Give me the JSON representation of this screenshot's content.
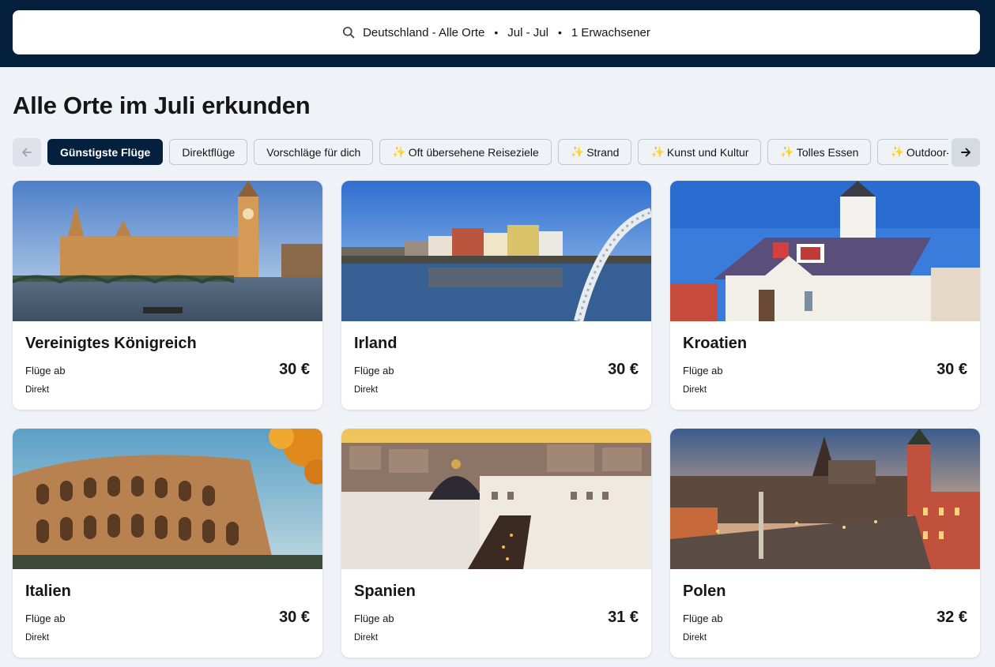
{
  "search": {
    "destination": "Deutschland - Alle Orte",
    "dates": "Jul - Jul",
    "travellers": "1 Erwachsener",
    "separator": "•",
    "icon": "search-icon"
  },
  "page": {
    "title": "Alle Orte im Juli erkunden"
  },
  "filters": {
    "prev_icon": "arrow-left-icon",
    "next_icon": "arrow-right-icon",
    "chips": [
      {
        "label": "Günstigste Flüge",
        "active": true,
        "sparkle": false
      },
      {
        "label": "Direktflüge",
        "active": false,
        "sparkle": false
      },
      {
        "label": "Vorschläge für dich",
        "active": false,
        "sparkle": false
      },
      {
        "label": "Oft übersehene Reiseziele",
        "active": false,
        "sparkle": true
      },
      {
        "label": "Strand",
        "active": false,
        "sparkle": true
      },
      {
        "label": "Kunst und Kultur",
        "active": false,
        "sparkle": true
      },
      {
        "label": "Tolles Essen",
        "active": false,
        "sparkle": true
      },
      {
        "label": "Outdoor-Aktivitäten",
        "active": false,
        "sparkle": true
      }
    ],
    "sparkle_glyph": "✨"
  },
  "destinations": [
    {
      "name": "Vereinigtes Königreich",
      "from_label": "Flüge ab",
      "price": "30 €",
      "stops": "Direkt",
      "image": "london-skyline"
    },
    {
      "name": "Irland",
      "from_label": "Flüge ab",
      "price": "30 €",
      "stops": "Direkt",
      "image": "dublin-river"
    },
    {
      "name": "Kroatien",
      "from_label": "Flüge ab",
      "price": "30 €",
      "stops": "Direkt",
      "image": "zagreb-church"
    },
    {
      "name": "Italien",
      "from_label": "Flüge ab",
      "price": "30 €",
      "stops": "Direkt",
      "image": "rome-colosseum"
    },
    {
      "name": "Spanien",
      "from_label": "Flüge ab",
      "price": "31 €",
      "stops": "Direkt",
      "image": "madrid-city"
    },
    {
      "name": "Polen",
      "from_label": "Flüge ab",
      "price": "32 €",
      "stops": "Direkt",
      "image": "warsaw-old-town"
    }
  ]
}
